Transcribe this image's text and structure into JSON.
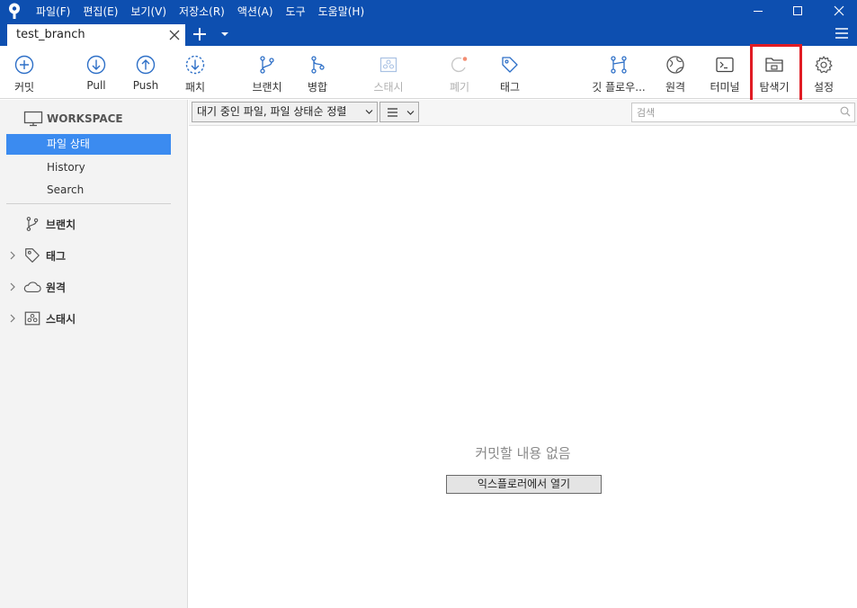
{
  "menu": {
    "items": [
      "파일(F)",
      "편집(E)",
      "보기(V)",
      "저장소(R)",
      "액션(A)",
      "도구",
      "도움말(H)"
    ]
  },
  "tab": {
    "title": "test_branch"
  },
  "toolbar": {
    "commit": "커밋",
    "pull": "Pull",
    "push": "Push",
    "fetch": "패치",
    "branch": "브랜치",
    "merge": "병합",
    "stash": "스태시",
    "discard": "폐기",
    "tag": "태그",
    "gitflow": "깃 플로우...",
    "remote": "원격",
    "terminal": "터미널",
    "explorer": "탐색기",
    "settings": "설정"
  },
  "sidebar": {
    "workspace": "WORKSPACE",
    "file_status": "파일 상태",
    "history": "History",
    "search": "Search",
    "branches": "브랜치",
    "tags": "태그",
    "remotes": "원격",
    "stashes": "스태시"
  },
  "main": {
    "filter_label": "대기 중인 파일, 파일 상태순 정렬",
    "search_placeholder": "검색",
    "empty_message": "커밋할 내용 없음",
    "open_explorer_button": "익스플로러에서 열기"
  },
  "colors": {
    "titlebar": "#0d4fb0",
    "selected": "#3b8bf0",
    "toolbar_icon": "#2d6fc7",
    "highlight": "#e01c24"
  }
}
